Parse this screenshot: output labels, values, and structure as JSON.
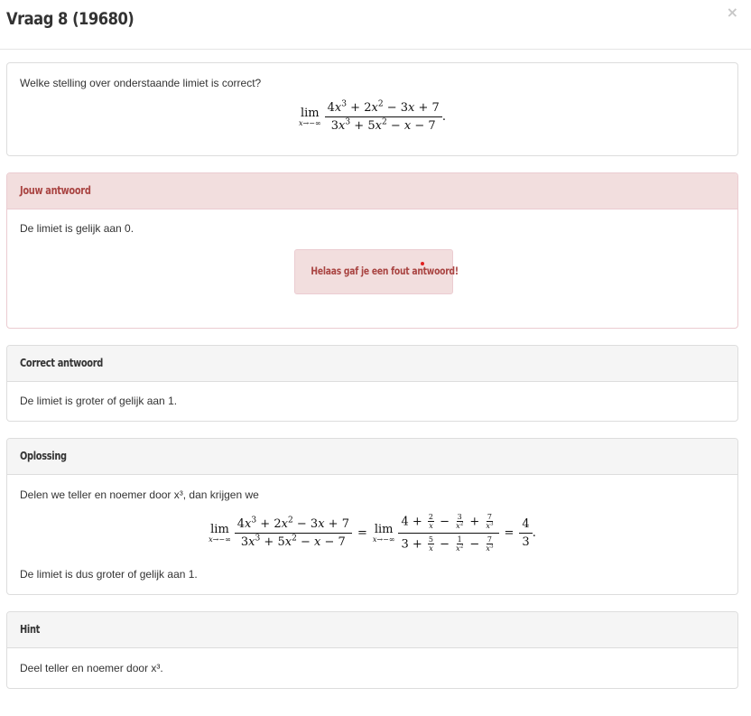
{
  "modal": {
    "title": "Vraag 8 (19680)",
    "close_icon": "×"
  },
  "question": {
    "text": "Welke stelling over onderstaande limiet is correct?",
    "lim": "lim",
    "lim_sub": "x→−∞",
    "numerator": "4x³ + 2x² − 3x + 7",
    "denominator": "3x³ + 5x² − x − 7"
  },
  "your_answer": {
    "heading": "Jouw antwoord",
    "text": "De limiet is gelijk aan 0.",
    "feedback": "Helaas gaf je een fout antwoord!"
  },
  "correct_answer": {
    "heading": "Correct antwoord",
    "text": "De limiet is groter of gelijk aan 1."
  },
  "solution": {
    "heading": "Oplossing",
    "intro": "Delen we teller en noemer door x³, dan krijgen we",
    "result": "4/3",
    "conclusion": "De limiet is dus groter of gelijk aan 1."
  },
  "hint": {
    "heading": "Hint",
    "text": "Deel teller en noemer door x³."
  },
  "colors": {
    "danger_bg": "#f2dede",
    "danger_text": "#a94442",
    "panel_bg": "#f5f5f5",
    "border": "#dddddd"
  }
}
